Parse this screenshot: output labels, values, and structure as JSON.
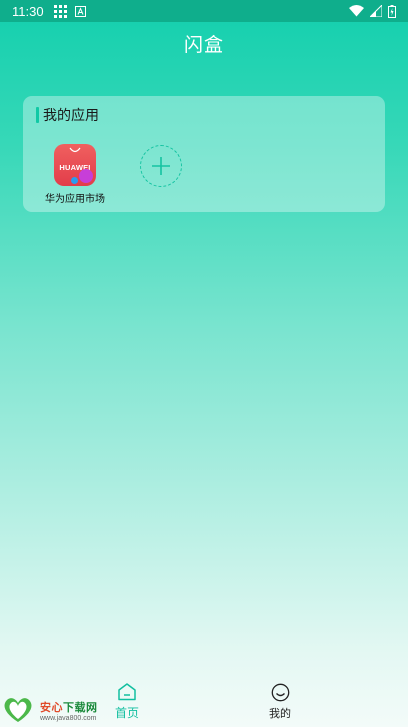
{
  "status_bar": {
    "time": "11:30",
    "icons": [
      "grid-icon",
      "a-notification-icon",
      "wifi-icon",
      "signal-icon",
      "battery-icon"
    ]
  },
  "header": {
    "title": "闪盒"
  },
  "my_apps": {
    "title": "我的应用",
    "apps": [
      {
        "label": "华为应用市场",
        "icon_text": "HUAWEI"
      }
    ],
    "add_icon": "plus-icon"
  },
  "bottom_nav": {
    "home_label": "首页",
    "mine_label": "我的",
    "accent": "#12bfa0"
  },
  "watermark": {
    "name_a": "安心",
    "name_b": "下载网",
    "url": "www.java800.com"
  }
}
